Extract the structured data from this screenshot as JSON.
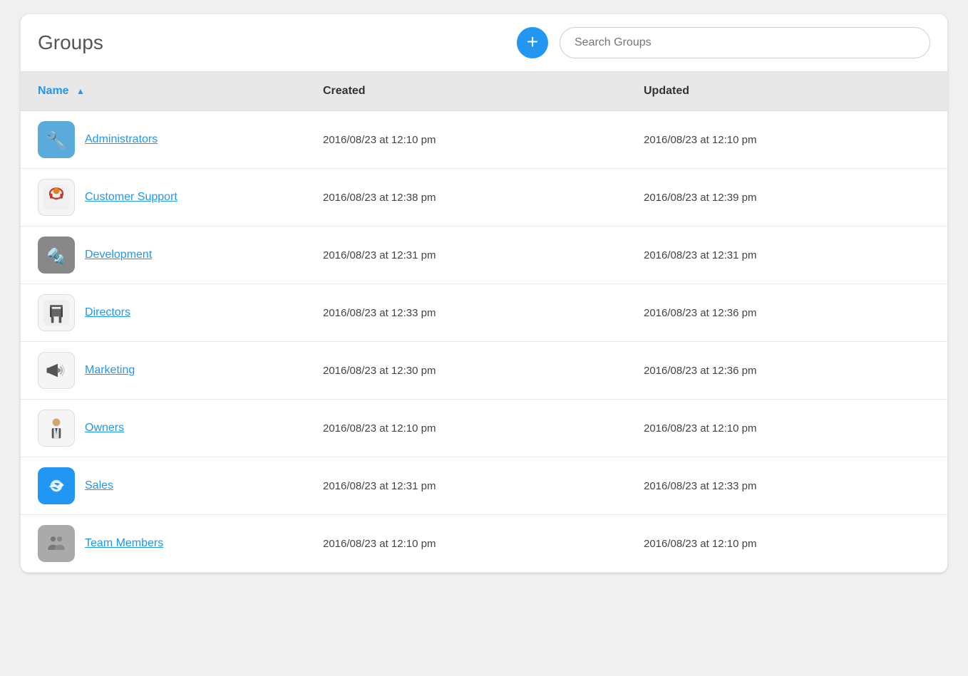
{
  "header": {
    "title": "Groups",
    "add_button_label": "+",
    "search_placeholder": "Search Groups"
  },
  "table": {
    "columns": [
      {
        "key": "name",
        "label": "Name",
        "sortable": true,
        "sort_direction": "asc"
      },
      {
        "key": "created",
        "label": "Created"
      },
      {
        "key": "updated",
        "label": "Updated"
      }
    ],
    "rows": [
      {
        "id": "administrators",
        "name": "Administrators",
        "created": "2016/08/23 at 12:10 pm",
        "updated": "2016/08/23 at 12:10 pm",
        "icon_type": "admin"
      },
      {
        "id": "customer-support",
        "name": "Customer Support",
        "created": "2016/08/23 at 12:38 pm",
        "updated": "2016/08/23 at 12:39 pm",
        "icon_type": "support"
      },
      {
        "id": "development",
        "name": "Development",
        "created": "2016/08/23 at 12:31 pm",
        "updated": "2016/08/23 at 12:31 pm",
        "icon_type": "dev"
      },
      {
        "id": "directors",
        "name": "Directors",
        "created": "2016/08/23 at 12:33 pm",
        "updated": "2016/08/23 at 12:36 pm",
        "icon_type": "directors"
      },
      {
        "id": "marketing",
        "name": "Marketing",
        "created": "2016/08/23 at 12:30 pm",
        "updated": "2016/08/23 at 12:36 pm",
        "icon_type": "marketing"
      },
      {
        "id": "owners",
        "name": "Owners",
        "created": "2016/08/23 at 12:10 pm",
        "updated": "2016/08/23 at 12:10 pm",
        "icon_type": "owners"
      },
      {
        "id": "sales",
        "name": "Sales",
        "created": "2016/08/23 at 12:31 pm",
        "updated": "2016/08/23 at 12:33 pm",
        "icon_type": "sales"
      },
      {
        "id": "team-members",
        "name": "Team Members",
        "created": "2016/08/23 at 12:10 pm",
        "updated": "2016/08/23 at 12:10 pm",
        "icon_type": "members"
      }
    ]
  }
}
